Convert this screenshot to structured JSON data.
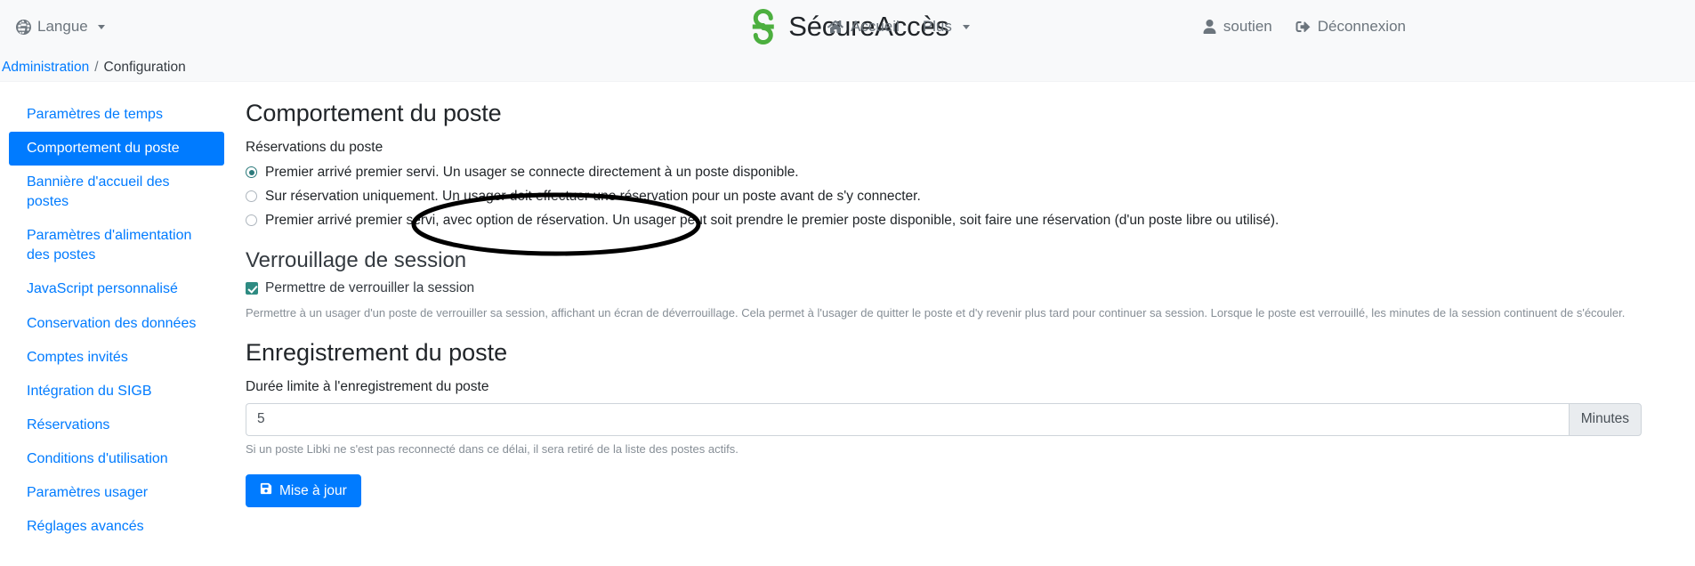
{
  "navbar": {
    "language": {
      "label": "Langue",
      "icon": "globe-icon"
    },
    "brand": {
      "name": "SécureAccès",
      "logo_color": "#4caf3f"
    },
    "center_links": [
      {
        "label": "Accueil",
        "icon": "home-icon"
      },
      {
        "label": "Plus",
        "icon": "chevron-down-icon"
      }
    ],
    "right_links": [
      {
        "label": "soutien",
        "icon": "user-icon"
      },
      {
        "label": "Déconnexion",
        "icon": "signout-icon"
      }
    ]
  },
  "breadcrumb": {
    "parent": "Administration",
    "separator": "/",
    "current": "Configuration"
  },
  "sidebar": {
    "active_index": 1,
    "items": [
      {
        "label": "Paramètres de temps"
      },
      {
        "label": "Comportement du poste"
      },
      {
        "label": "Bannière d'accueil des postes"
      },
      {
        "label": "Paramètres d'alimentation des postes"
      },
      {
        "label": "JavaScript personnalisé"
      },
      {
        "label": "Conservation des données"
      },
      {
        "label": "Comptes invités"
      },
      {
        "label": "Intégration du SIGB"
      },
      {
        "label": "Réservations"
      },
      {
        "label": "Conditions d'utilisation"
      },
      {
        "label": "Paramètres usager"
      },
      {
        "label": "Réglages avancés"
      }
    ]
  },
  "main": {
    "section_title": "Comportement du poste",
    "reservations_label": "Réservations du poste",
    "radio_options": [
      {
        "label": "Premier arrivé premier servi. Un usager se connecte directement à un poste disponible.",
        "selected": true
      },
      {
        "label": "Sur réservation uniquement. Un usager doit effectuer une réservation pour un poste avant de s'y connecter.",
        "selected": false
      },
      {
        "label": "Premier arrivé premier servi, avec option de réservation. Un usager peut soit prendre le premier poste disponible, soit faire une réservation (d'un poste libre ou utilisé).",
        "selected": false
      }
    ],
    "session_lock": {
      "heading": "Verrouillage de session",
      "checkbox_label": "Permettre de verrouiller la session",
      "checked": true,
      "help_text": "Permettre à un usager d'un poste de verrouiller sa session, affichant un écran de déverrouillage. Cela permet à l'usager de quitter le poste et d'y revenir plus tard pour continuer sa session. Lorsque le poste est verrouillé, les minutes de la session continuent de s'écouler."
    },
    "registration": {
      "heading": "Enregistrement du poste",
      "field_label": "Durée limite à l'enregistrement du poste",
      "value": "5",
      "placeholder": "",
      "unit_addon": "Minutes",
      "help_text": "Si un poste Libki ne s'est pas reconnecté dans ce délai, il sera retiré de la liste des postes actifs.",
      "submit_label": "Mise à jour",
      "submit_icon": "save-icon"
    }
  },
  "annotation": {
    "type": "ellipse",
    "color": "#000000",
    "target": "Verrouillage de session"
  }
}
